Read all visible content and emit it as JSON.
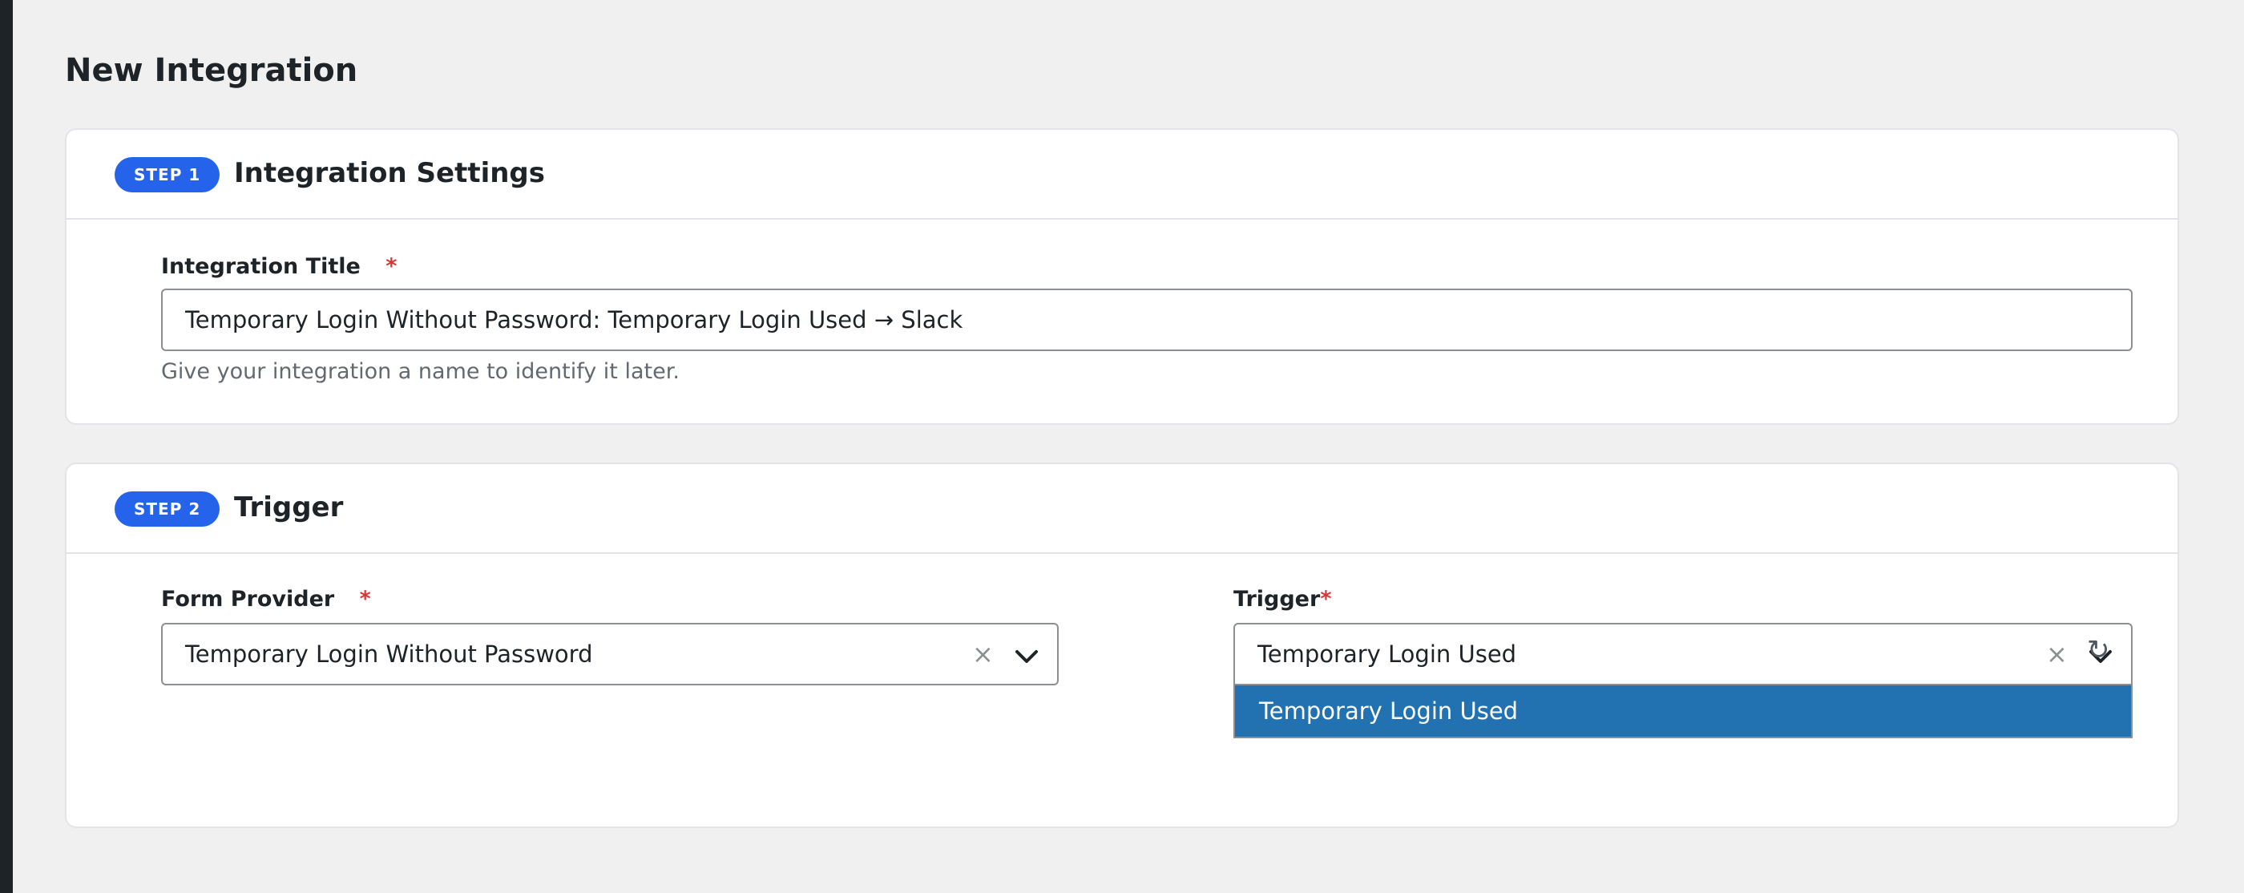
{
  "page": {
    "title": "New Integration"
  },
  "step1": {
    "badge": "STEP 1",
    "title": "Integration Settings",
    "title_field": {
      "label": "Integration Title",
      "required_mark": "*",
      "value": "Temporary Login Without Password: Temporary Login Used → Slack",
      "help": "Give your integration a name to identify it later."
    }
  },
  "step2": {
    "badge": "STEP 2",
    "title": "Trigger",
    "form_provider": {
      "label": "Form Provider",
      "required_mark": "*",
      "selected": "Temporary Login Without Password",
      "clear_glyph": "×"
    },
    "trigger": {
      "label": "Trigger",
      "required_mark": "*",
      "selected": "Temporary Login Used",
      "clear_glyph": "×",
      "options": [
        "Temporary Login Used"
      ]
    },
    "refresh_glyph": "↻"
  },
  "icons": {
    "clear": "close-icon",
    "dropdown": "chevron-down-icon",
    "refresh": "refresh-icon"
  },
  "colors": {
    "accent": "#2563eb",
    "required": "#d63638",
    "option_highlight": "#2271b1"
  }
}
